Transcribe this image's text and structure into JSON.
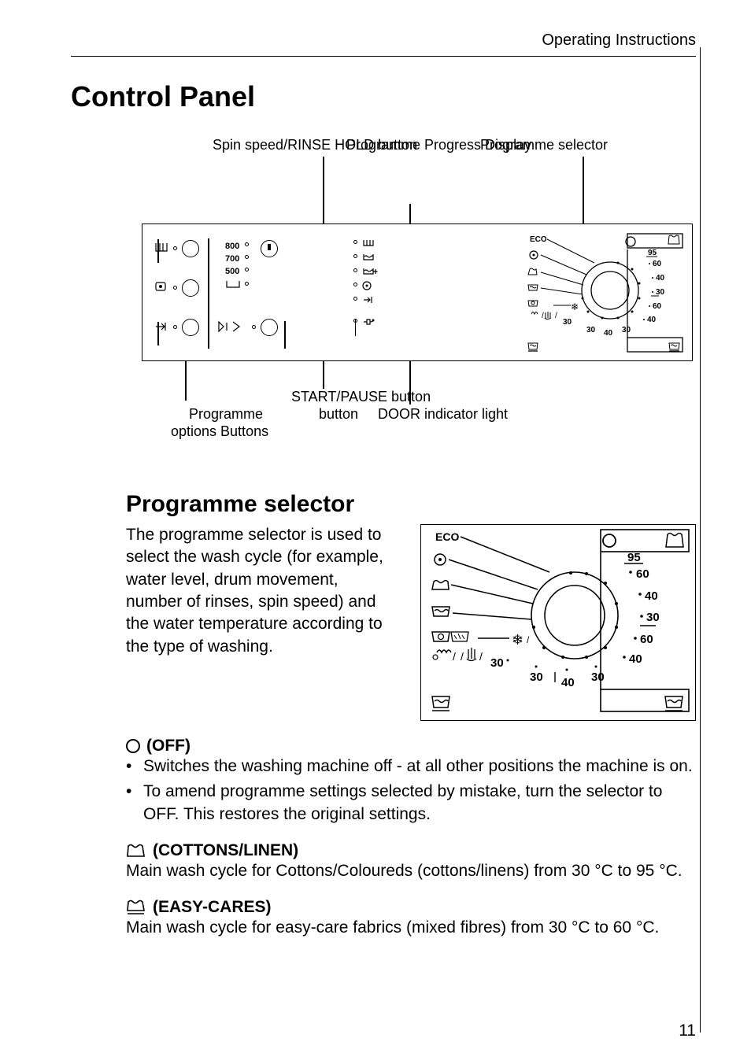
{
  "header": {
    "category": "Operating Instructions"
  },
  "page_number": "11",
  "sections": {
    "control_panel": {
      "title": "Control Panel",
      "callouts": {
        "spin_rinse": "Spin speed/RINSE HOLD button",
        "prog_selector": "Programme selector",
        "prog_progress": "Programme Progress Display",
        "start_pause": "START/PAUSE button",
        "door_indicator": "DOOR indicator light",
        "prog_options": "Programme options Buttons"
      },
      "speeds": [
        "800",
        "700",
        "500"
      ]
    },
    "programme_selector": {
      "title": "Programme selector",
      "intro": "The programme selector is used to select the wash cycle (for example, water level, drum movement, number of rinses, spin speed) and the water temperature according to the type of washing.",
      "dial": {
        "eco": "ECO",
        "temps_right": [
          "95",
          "60",
          "40",
          "30",
          "60",
          "40"
        ],
        "temps_bottom": [
          "30",
          "30",
          "40",
          "30"
        ]
      },
      "off": {
        "label": "(OFF)",
        "bullets": [
          "Switches the washing machine off - at all other positions the machine is on.",
          "To amend programme settings selected by mistake, turn the selector to OFF. This restores the original settings."
        ]
      },
      "cottons": {
        "label": "(COTTONS/LINEN)",
        "text": "Main wash cycle for Cottons/Coloureds (cottons/linens) from 30 °C to 95 °C."
      },
      "easycares": {
        "label": "(EASY-CARES)",
        "text": "Main wash cycle for easy-care fabrics (mixed fibres) from 30 °C to 60 °C."
      }
    }
  }
}
